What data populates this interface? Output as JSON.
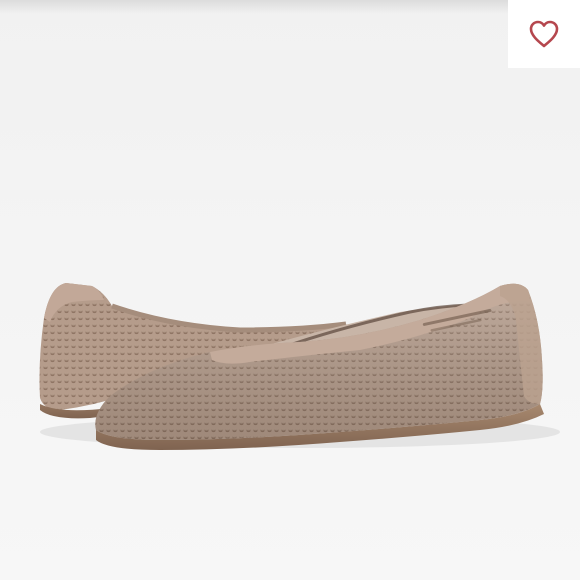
{
  "listing": {
    "image_subject": "shoe-photo",
    "like_icon": "heart-outline-icon",
    "colors": {
      "heart": "#b5474e",
      "shoe_knit": "#b9a08f",
      "shoe_sole": "#9c7d68",
      "background": "#f2f2f2"
    }
  }
}
